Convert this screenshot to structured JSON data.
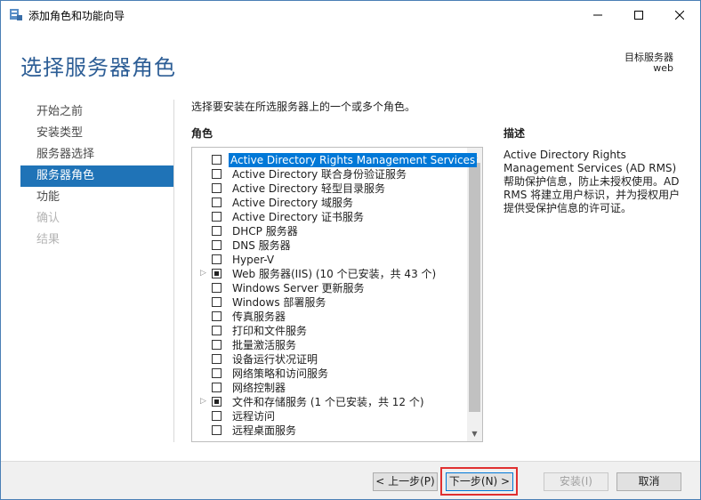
{
  "window": {
    "title": "添加角色和功能向导"
  },
  "header": {
    "page_title": "选择服务器角色",
    "target_label": "目标服务器",
    "target_value": "web"
  },
  "nav": [
    {
      "label": "开始之前",
      "state": "normal"
    },
    {
      "label": "安装类型",
      "state": "normal"
    },
    {
      "label": "服务器选择",
      "state": "normal"
    },
    {
      "label": "服务器角色",
      "state": "active"
    },
    {
      "label": "功能",
      "state": "normal"
    },
    {
      "label": "确认",
      "state": "disabled"
    },
    {
      "label": "结果",
      "state": "disabled"
    }
  ],
  "main": {
    "instructions": "选择要安装在所选服务器上的一个或多个角色。",
    "roles_header": "角色",
    "roles": [
      {
        "label": "Active Directory Rights Management Services",
        "selected": true,
        "checked": "none",
        "expandable": false
      },
      {
        "label": "Active Directory 联合身份验证服务",
        "checked": "none",
        "expandable": false
      },
      {
        "label": "Active Directory 轻型目录服务",
        "checked": "none",
        "expandable": false
      },
      {
        "label": "Active Directory 域服务",
        "checked": "none",
        "expandable": false
      },
      {
        "label": "Active Directory 证书服务",
        "checked": "none",
        "expandable": false
      },
      {
        "label": "DHCP 服务器",
        "checked": "none",
        "expandable": false
      },
      {
        "label": "DNS 服务器",
        "checked": "none",
        "expandable": false
      },
      {
        "label": "Hyper-V",
        "checked": "none",
        "expandable": false
      },
      {
        "label": "Web 服务器(IIS) (10 个已安装，共 43 个)",
        "checked": "partial",
        "expandable": true
      },
      {
        "label": "Windows Server 更新服务",
        "checked": "none",
        "expandable": false
      },
      {
        "label": "Windows 部署服务",
        "checked": "none",
        "expandable": false
      },
      {
        "label": "传真服务器",
        "checked": "none",
        "expandable": false
      },
      {
        "label": "打印和文件服务",
        "checked": "none",
        "expandable": false
      },
      {
        "label": "批量激活服务",
        "checked": "none",
        "expandable": false
      },
      {
        "label": "设备运行状况证明",
        "checked": "none",
        "expandable": false
      },
      {
        "label": "网络策略和访问服务",
        "checked": "none",
        "expandable": false
      },
      {
        "label": "网络控制器",
        "checked": "none",
        "expandable": false
      },
      {
        "label": "文件和存储服务 (1 个已安装，共 12 个)",
        "checked": "partial",
        "expandable": true
      },
      {
        "label": "远程访问",
        "checked": "none",
        "expandable": false
      },
      {
        "label": "远程桌面服务",
        "checked": "none",
        "expandable": false
      }
    ],
    "description_header": "描述",
    "description": "Active Directory Rights Management Services (AD RMS) 帮助保护信息，防止未授权使用。AD RMS 将建立用户标识，并为授权用户提供受保护信息的许可证。"
  },
  "footer": {
    "prev_label": "< 上一步(P)",
    "next_label": "下一步(N) >",
    "install_label": "安装(I)",
    "cancel_label": "取消"
  }
}
